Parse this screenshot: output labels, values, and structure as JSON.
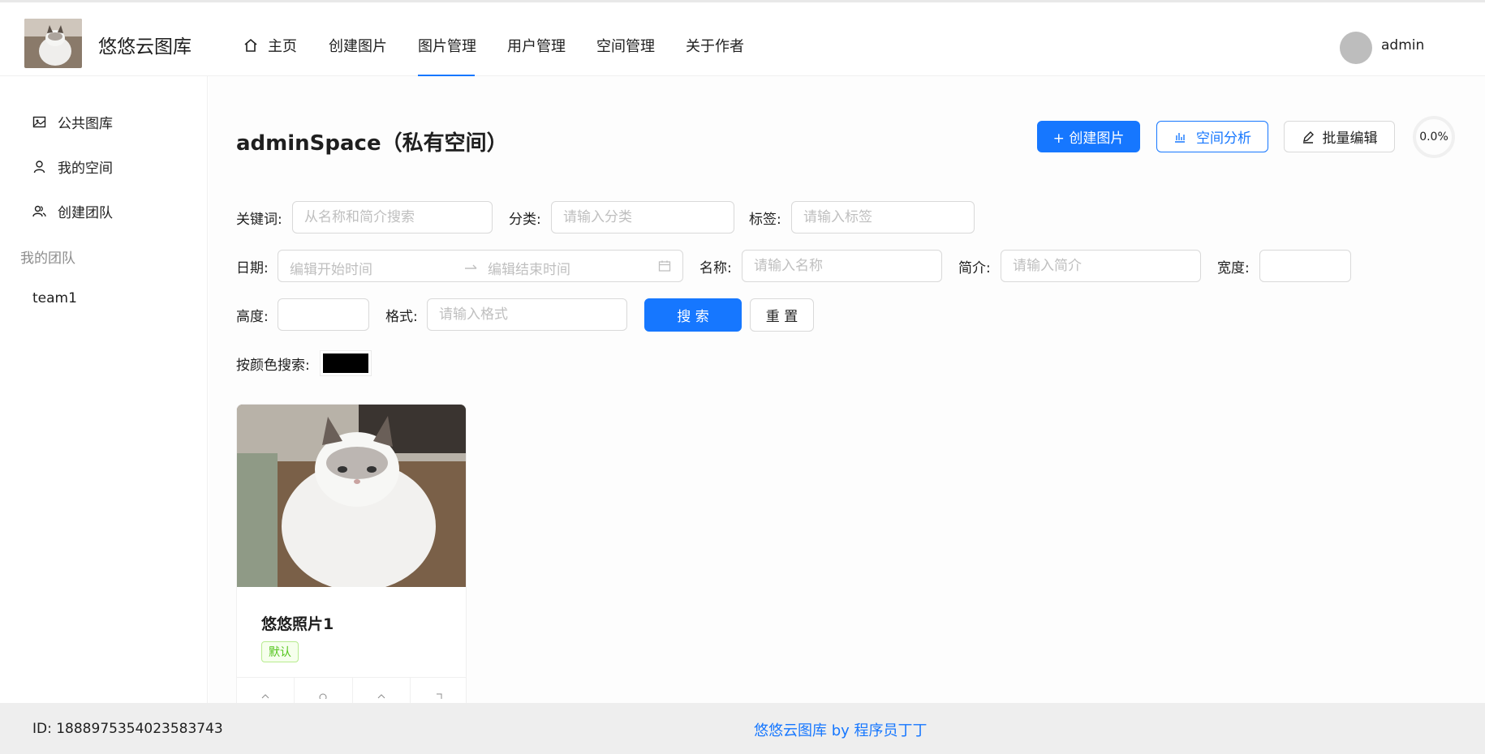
{
  "header": {
    "site_title": "悠悠云图库",
    "nav": [
      {
        "label": "主页"
      },
      {
        "label": "创建图片"
      },
      {
        "label": "图片管理"
      },
      {
        "label": "用户管理"
      },
      {
        "label": "空间管理"
      },
      {
        "label": "关于作者"
      }
    ],
    "active_nav": "图片管理",
    "username": "admin",
    "accent_color": "#1677ff"
  },
  "sidebar": {
    "items": [
      {
        "label": "公共图库",
        "icon": "picture-icon"
      },
      {
        "label": "我的空间",
        "icon": "user-icon"
      },
      {
        "label": "创建团队",
        "icon": "team-icon"
      }
    ],
    "group_title": "我的团队",
    "teams": [
      "team1"
    ]
  },
  "main": {
    "title": "adminSpace（私有空间）",
    "buttons": {
      "create": "+ 创建图片",
      "analyze": "空间分析",
      "batch_edit": "批量编辑"
    },
    "usage_percent": "0.0%",
    "filters": {
      "keyword_label": "关键词:",
      "keyword_placeholder": "从名称和简介搜索",
      "category_label": "分类:",
      "category_placeholder": "请输入分类",
      "tags_label": "标签:",
      "tags_placeholder": "请输入标签",
      "date_label": "日期:",
      "date_start_placeholder": "编辑开始时间",
      "date_end_placeholder": "编辑结束时间",
      "name_label": "名称:",
      "name_placeholder": "请输入名称",
      "intro_label": "简介:",
      "intro_placeholder": "请输入简介",
      "width_label": "宽度:",
      "height_label": "高度:",
      "format_label": "格式:",
      "format_placeholder": "请输入格式",
      "search_button": "搜 索",
      "reset_button": "重 置",
      "color_label": "按颜色搜索:",
      "color_value": "#000000"
    },
    "pictures": [
      {
        "title": "悠悠照片1",
        "tag": "默认"
      }
    ]
  },
  "footer": {
    "id_text": "ID: 1888975354023583743",
    "credit": "悠悠云图库 by 程序员丁丁"
  }
}
